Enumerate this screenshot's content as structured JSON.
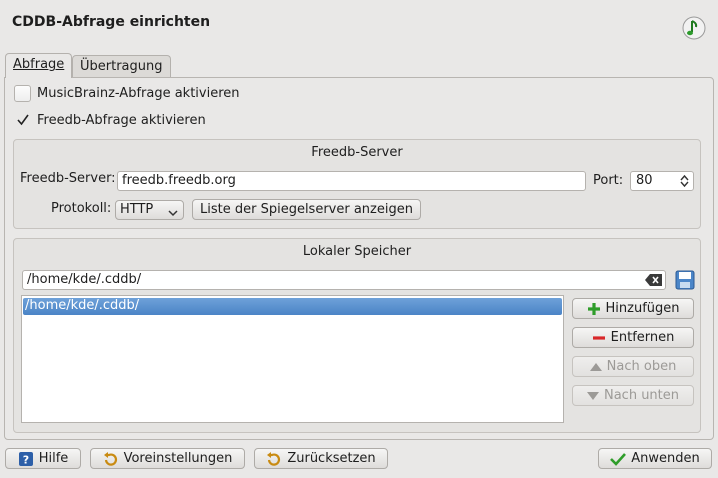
{
  "window": {
    "title": "CDDB-Abfrage einrichten",
    "icon": "music-note-icon"
  },
  "tabs": [
    {
      "label": "Abfrage",
      "active": true
    },
    {
      "label": "Übertragung",
      "active": false
    }
  ],
  "checkboxes": [
    {
      "label": "MusicBrainz-Abfrage aktivieren",
      "checked": false
    },
    {
      "label": "Freedb-Abfrage aktivieren",
      "checked": true
    }
  ],
  "freedb": {
    "group_title": "Freedb-Server",
    "server_label": "Freedb-Server:",
    "server_value": "freedb.freedb.org",
    "port_label": "Port:",
    "port_value": "80",
    "protocol_label": "Protokoll:",
    "protocol_value": "HTTP",
    "mirror_button": "Liste der Spiegelserver anzeigen"
  },
  "local": {
    "group_title": "Lokaler Speicher",
    "path_value": "/home/kde/.cddb/",
    "list_items": [
      "/home/kde/.cddb/"
    ],
    "buttons": {
      "add": "Hinzufügen",
      "remove": "Entfernen",
      "up": "Nach oben",
      "down": "Nach unten"
    }
  },
  "footer": {
    "help": "Hilfe",
    "defaults": "Voreinstellungen",
    "reset": "Zurücksetzen",
    "apply": "Anwenden"
  },
  "colors": {
    "background": "#e9e8e7",
    "selection": "#4b84c6",
    "add_icon": "#2f9d2a",
    "remove_icon": "#d9272a"
  }
}
